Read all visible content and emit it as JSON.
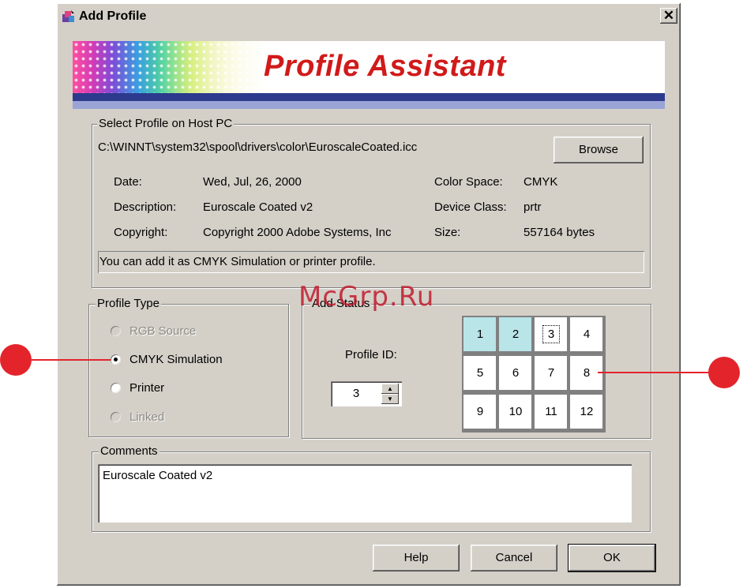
{
  "window": {
    "title": "Add Profile",
    "close_glyph": "✕"
  },
  "banner": {
    "title": "Profile Assistant"
  },
  "select_profile": {
    "legend": "Select Profile on Host PC",
    "path": "C:\\WINNT\\system32\\spool\\drivers\\color\\EuroscaleCoated.icc",
    "browse_label": "Browse",
    "date_label": "Date:",
    "date_value": "Wed, Jul, 26, 2000",
    "description_label": "Description:",
    "description_value": "Euroscale Coated v2",
    "copyright_label": "Copyright:",
    "copyright_value": "Copyright 2000 Adobe Systems, Inc",
    "color_space_label": "Color Space:",
    "color_space_value": "CMYK",
    "device_class_label": "Device Class:",
    "device_class_value": "prtr",
    "size_label": "Size:",
    "size_value": "557164 bytes",
    "status_message": "You can add it as CMYK Simulation or printer profile."
  },
  "profile_type": {
    "legend": "Profile Type",
    "options": [
      {
        "label": "RGB Source",
        "enabled": false,
        "selected": false
      },
      {
        "label": "CMYK Simulation",
        "enabled": true,
        "selected": true
      },
      {
        "label": "Printer",
        "enabled": true,
        "selected": false
      },
      {
        "label": "Linked",
        "enabled": false,
        "selected": false
      }
    ]
  },
  "add_status": {
    "legend": "Add Status",
    "profile_id_label": "Profile ID:",
    "profile_id_value": "3",
    "slots": [
      "1",
      "2",
      "3",
      "4",
      "5",
      "6",
      "7",
      "8",
      "9",
      "10",
      "11",
      "12"
    ],
    "used_slots": [
      "1",
      "2"
    ],
    "focused_slot": "3"
  },
  "comments": {
    "legend": "Comments",
    "value": "Euroscale Coated v2"
  },
  "buttons": {
    "help": "Help",
    "cancel": "Cancel",
    "ok": "OK"
  },
  "watermark": "McGrp.Ru",
  "colors": {
    "dialog_bg": "#d4d0c8",
    "banner_title": "#d11a1a",
    "banner_stripe": "#2b3a8c",
    "used_slot": "#b9e4e8",
    "callout": "#e3242b"
  }
}
